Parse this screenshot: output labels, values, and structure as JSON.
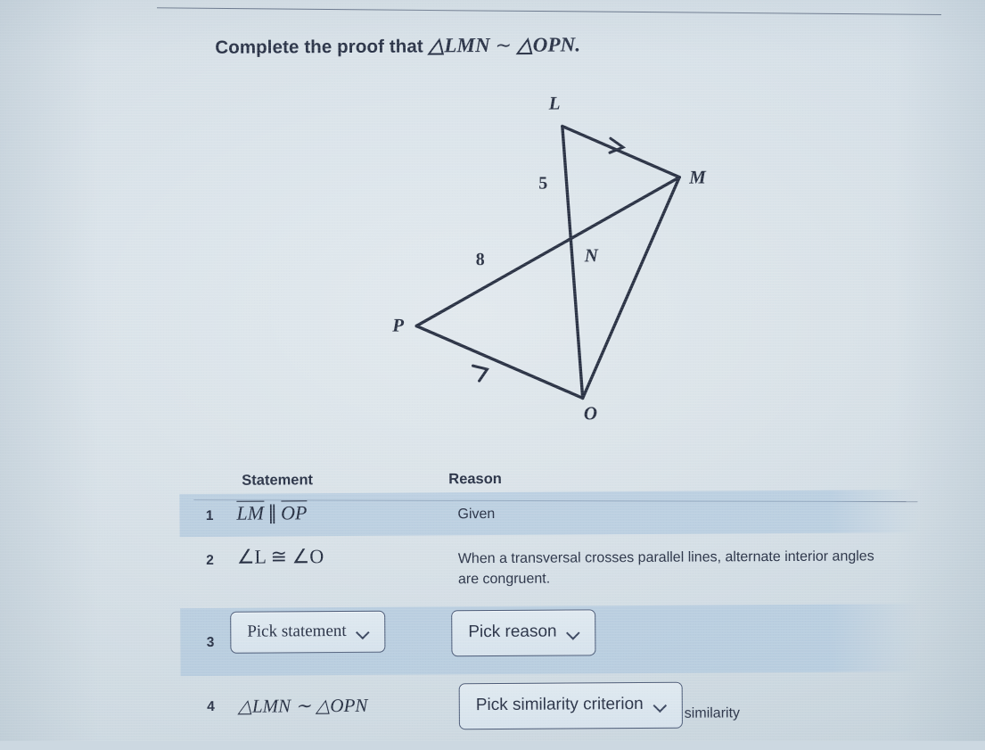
{
  "prompt": {
    "lead": "Complete the proof that",
    "triangle1": "△LMN",
    "similar_symbol": "∼",
    "triangle2": "△OPN",
    "period": "."
  },
  "figure": {
    "labels": {
      "L": "L",
      "M": "M",
      "N": "N",
      "O": "O",
      "P": "P"
    },
    "side_lengths": {
      "LN": "5",
      "PN": "8"
    },
    "tick_marks": "single-arrow-parallel-marks"
  },
  "table": {
    "headers": {
      "statement": "Statement",
      "reason": "Reason"
    },
    "rows": [
      {
        "num": "1",
        "statement_a": "LM",
        "statement_par": "∥",
        "statement_b": "OP",
        "reason": "Given"
      },
      {
        "num": "2",
        "statement": "∠L ≅ ∠O",
        "reason": "When a transversal crosses parallel lines, alternate interior angles are congruent."
      },
      {
        "num": "3",
        "statement_button": "Pick statement",
        "reason_button": "Pick reason"
      },
      {
        "num": "4",
        "statement": "△LMN ∼ △OPN",
        "reason_button": "Pick similarity criterion",
        "reason_suffix": "similarity"
      }
    ]
  },
  "colors": {
    "page_background": "#ccd8e0",
    "row_highlight": "#aac4dc",
    "ink": "#2b3448",
    "button_border": "#4d5c78"
  }
}
